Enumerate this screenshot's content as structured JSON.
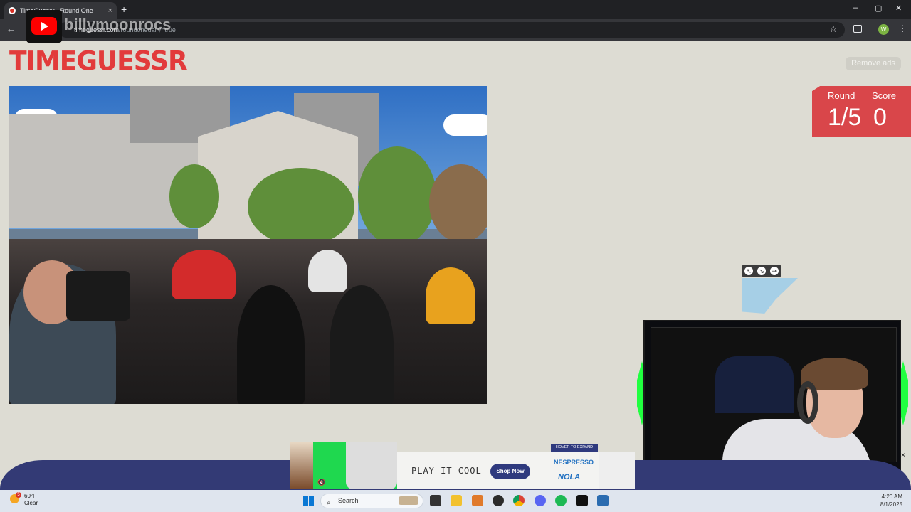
{
  "browser": {
    "tab_title": "TimeGuessr - Round One",
    "tab_close": "×",
    "new_tab": "+",
    "url_host": "timeguessr.com",
    "url_rest": "/roundonedaily=true",
    "window_controls": [
      "–",
      "▢",
      "✕"
    ]
  },
  "overlay": {
    "channel_handle": "billymoonrocs"
  },
  "page": {
    "logo": "TIMEGUESSR",
    "remove_ads": "Remove ads",
    "round_label": "Round",
    "round_value": "1/5",
    "score_label": "Score",
    "score_value": "0"
  },
  "map": {
    "tools": [
      "expand-icon",
      "shrink-icon",
      "pin-icon"
    ]
  },
  "ad": {
    "tagline": "PLAY IT COOL",
    "cta": "Shop Now",
    "brand": "NESPRESSO",
    "product": "NOLA",
    "hover": "HOVER TO EXPAND",
    "close": "×"
  },
  "taskbar": {
    "weather_temp": "60°F",
    "weather_cond": "Clear",
    "weather_badge": "5",
    "search_placeholder": "Search",
    "time": "4:20 AM",
    "date": "8/1/2025"
  },
  "colors": {
    "page_bg": "#dddcd3",
    "accent_red": "#d9464a",
    "ad_navy": "#333a75",
    "neon_green": "#20ff40"
  }
}
